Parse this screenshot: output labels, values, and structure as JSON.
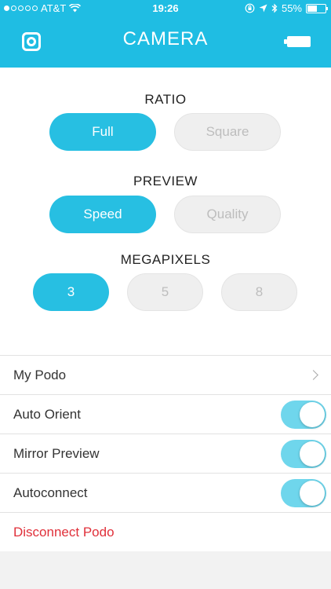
{
  "status": {
    "carrier": "AT&T",
    "time": "19:26",
    "battery": "55%",
    "battery_level": 0.55
  },
  "header": {
    "title": "CAMERA",
    "left_icon": "camera-icon",
    "right_icon": "battery-icon",
    "accent_color": "#1fbde3"
  },
  "ratio": {
    "label": "RATIO",
    "options": [
      "Full",
      "Square"
    ],
    "selected": "Full"
  },
  "preview": {
    "label": "PREVIEW",
    "options": [
      "Speed",
      "Quality"
    ],
    "selected": "Speed"
  },
  "megapixels": {
    "label": "MEGAPIXELS",
    "options": [
      "3",
      "5",
      "8"
    ],
    "selected": "3"
  },
  "list": {
    "my_podo": "My Podo",
    "auto_orient": "Auto Orient",
    "auto_orient_on": true,
    "mirror_preview": "Mirror Preview",
    "mirror_preview_on": true,
    "autoconnect": "Autoconnect",
    "autoconnect_on": true,
    "disconnect": "Disconnect Podo",
    "danger_color": "#e0303a"
  }
}
